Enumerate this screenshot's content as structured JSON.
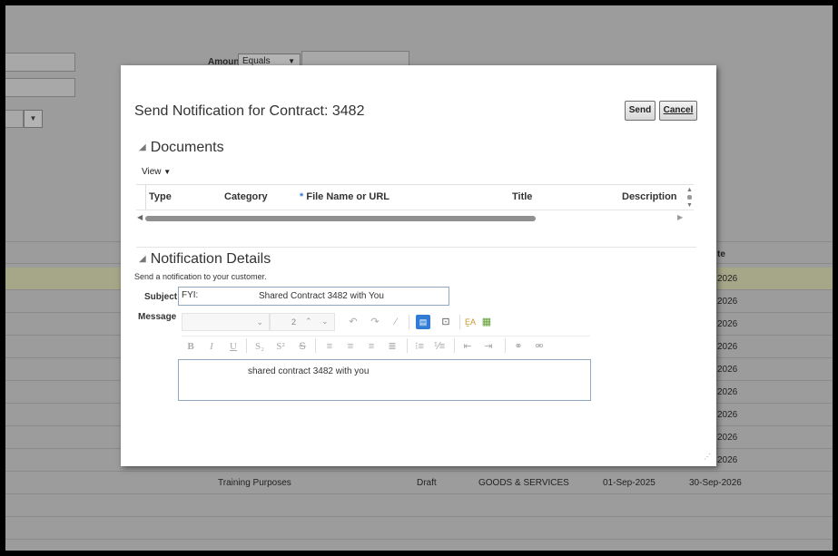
{
  "background": {
    "amount_label": "Amount",
    "amount_operator": "Equals",
    "column_header_right": "te",
    "right_dates": [
      "2026",
      "2026",
      "2026",
      "2026",
      "2026",
      "2026",
      "2026",
      "2026",
      "2026"
    ],
    "visible_row": {
      "description": "Training Purposes",
      "status": "Draft",
      "type": "GOODS & SERVICES",
      "start_date": "01-Sep-2025",
      "end_date": "30-Sep-2026"
    }
  },
  "dialog": {
    "title": "Send Notification for Contract: 3482",
    "send_label": "Send",
    "cancel_label": "Cancel",
    "documents": {
      "heading": "Documents",
      "view_label": "View",
      "columns": [
        "Type",
        "Category",
        "* File Name or URL",
        "Title",
        "Description"
      ]
    },
    "notification": {
      "heading": "Notification Details",
      "hint": "Send a notification to your customer.",
      "subject_label": "Subject",
      "subject_prefix": "FYI:",
      "subject_text": "Shared Contract 3482 with You",
      "message_label": "Message",
      "font_size_value": "2",
      "message_text": "shared contract 3482 with you"
    }
  },
  "icons": {
    "collapse": "▲",
    "dropdown": "▼",
    "undo": "↶",
    "redo": "↷",
    "eraser": "⌫"
  }
}
